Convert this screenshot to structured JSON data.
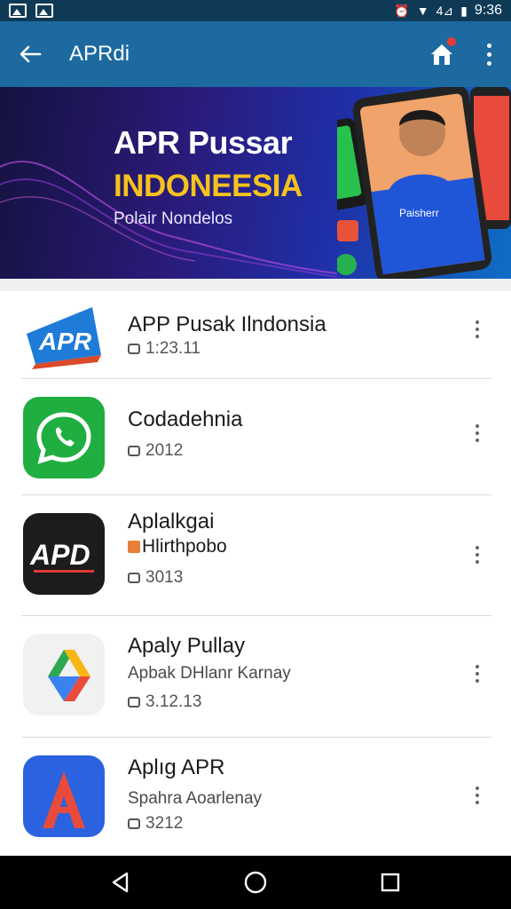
{
  "status_bar": {
    "time": "9:36",
    "signal_text": "4⊿",
    "icons": [
      "gallery-icon",
      "image-icon",
      "alarm-icon",
      "wifi-icon",
      "signal-icon",
      "battery-icon"
    ]
  },
  "app_bar": {
    "title": "APRdi",
    "icons": [
      "back-arrow-icon",
      "home-icon",
      "more-vert-icon"
    ]
  },
  "banner": {
    "title": "APR Pussar",
    "subtitle": "INDONEESIA",
    "tagline": "Polair Nondelos",
    "phone_card_text": "Paisherr"
  },
  "apps": [
    {
      "title": "APP Pusak Ilndonsia",
      "subtitle": "",
      "meta": "1:23.11",
      "icon": "apr-logo-icon"
    },
    {
      "title": "Codadehnia",
      "subtitle": "",
      "meta": "2012",
      "icon": "whatsapp-icon"
    },
    {
      "title": "Aplalkgai",
      "subtitle": "Hlirthpobo",
      "meta": "3013",
      "icon": "apd-logo-icon"
    },
    {
      "title": "Apaly Pullay",
      "subtitle": "Apbak DHlanr Karnay",
      "meta": "3.12.13",
      "icon": "google-drive-icon"
    },
    {
      "title": "Aplıg APR",
      "subtitle": "Spahra Aoarlenay",
      "meta": "3212",
      "icon": "apr-a-logo-icon"
    }
  ],
  "nav": {
    "icons": [
      "back-nav-icon",
      "home-nav-icon",
      "recents-nav-icon"
    ]
  },
  "colors": {
    "app_bar": "#1c6aa0",
    "status_bar": "#0f3a56",
    "banner_yellow": "#f6c21c",
    "divider": "#dadada"
  }
}
